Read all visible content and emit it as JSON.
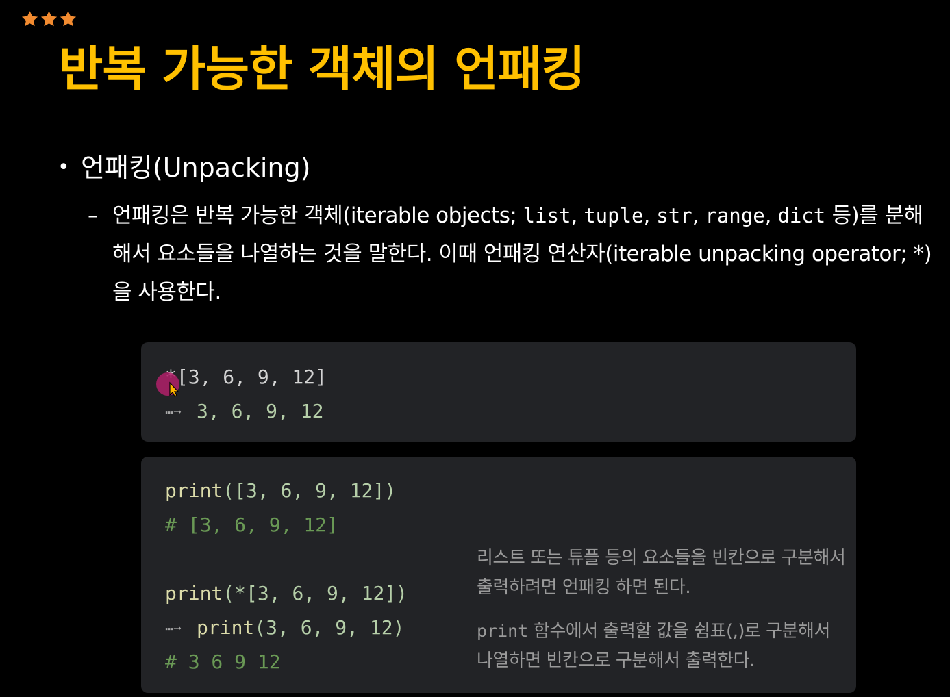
{
  "header": {
    "rating_stars": 3,
    "star_color": "#f28b30",
    "title": "반복 가능한 객체의 언패킹",
    "title_color": "#ffc000"
  },
  "bullet": {
    "marker": "•",
    "text": "언패킹(Unpacking)"
  },
  "sub": {
    "marker": "–",
    "parts": [
      "언패킹은 반복 가능한 객체(iterable objects; ",
      "list",
      ", ",
      "tuple",
      ", ",
      "str",
      ", ",
      "range",
      ", ",
      "dict",
      " 등)를 분해해서 요소들을 나열하는 것을 말한다. 이때 언패킹 연산자(iterable unpacking operator; *)을 사용한다."
    ]
  },
  "code_box_1": {
    "line1": "*[3, 6, 9, 12]",
    "line2_arrow": "⋯➝",
    "line2": "3, 6, 9, 12"
  },
  "code_box_2": {
    "line1_fn": "print",
    "line1_args": "([3, 6, 9, 12])",
    "line2": "# [3, 6, 9, 12]",
    "line3_fn": "print",
    "line3_args": "(*[3, 6, 9, 12])",
    "line4_arrow": "⋯➝",
    "line4_fn": "print",
    "line4_args": "(3, 6, 9, 12)",
    "line5": "# 3 6 9 12",
    "note1_line1": "리스트 또는 튜플 등의 요소들을 빈칸으로 구분해서",
    "note1_line2": "출력하려면 언패킹 하면 된다.",
    "note2_code": "print",
    "note2_line1_rest": " 함수에서 출력할 값을 쉼표(,)로 구분해서",
    "note2_line2": "나열하면 빈칸으로 구분해서 출력한다."
  },
  "colors": {
    "background": "#000000",
    "code_bg": "#222326",
    "number": "#b5cea8",
    "function": "#dcdcaa",
    "comment": "#6a9955",
    "note": "#9a9a9a",
    "cursor_highlight": "#b0206a"
  }
}
